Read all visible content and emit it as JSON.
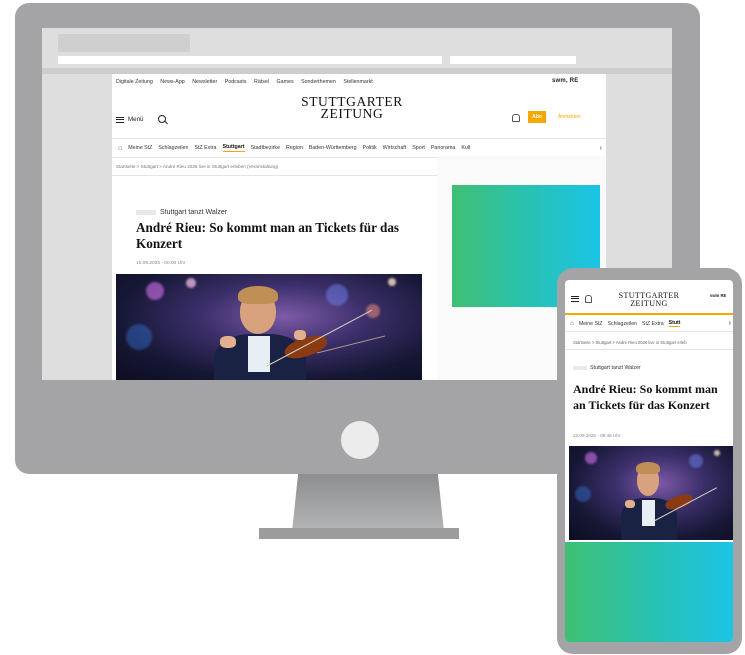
{
  "colors": {
    "accent": "#f5a800",
    "device_frame": "#a4a4a6",
    "ad_gradient_start": "#3fbf73",
    "ad_gradient_end": "#1cc4e6"
  },
  "desktop": {
    "top_nav": [
      "Digitale Zeitung",
      "News-App",
      "Newsletter",
      "Podcasts",
      "Rätsel",
      "Games",
      "Sonderthemen",
      "Stellenmarkt"
    ],
    "brand_small": "swm, RE",
    "logo_line1": "STUTTGARTER",
    "logo_line2": "ZEITUNG",
    "menu_label": "Menü",
    "abo_label": "Abo",
    "login_label": "Anmelden",
    "categories": [
      "Meine StZ",
      "Schlagzeilen",
      "StZ Extra",
      "Stuttgart",
      "Stadtbezirke",
      "Region",
      "Baden-Württemberg",
      "Politik",
      "Wirtschaft",
      "Sport",
      "Panorama",
      "Kult"
    ],
    "active_category": "Stuttgart",
    "breadcrumb": "Startseite  >  Stuttgart  >  André Rieu 2026 live in Stuttgart erleben (Veranstaltung)",
    "kicker": "Stuttgart tanzt Walzer",
    "headline": "André Rieu: So kommt man an Tickets für das Konzert",
    "date": "15.09.2025 - 00:00 Uhr",
    "icons": [
      "menu-icon",
      "search-icon",
      "bell-icon",
      "home-icon",
      "chevron-right-icon"
    ]
  },
  "mobile": {
    "logo_line1": "STUTTGARTER",
    "logo_line2": "ZEITUNG",
    "brand_small": "swm RE",
    "categories": [
      "Meine StZ",
      "Schlagzeilen",
      "StZ Extra",
      "Stutt"
    ],
    "active_category": "Stutt",
    "breadcrumb": "Startseite  >  Stuttgart  >  André Rieu 2026 live in Stuttgart erleb",
    "kicker": "Stuttgart tanzt Walzer",
    "headline": "André Rieu: So kommt man an Tickets für das Konzert",
    "date": "22.09.2025 - 08:48 Uhr"
  }
}
